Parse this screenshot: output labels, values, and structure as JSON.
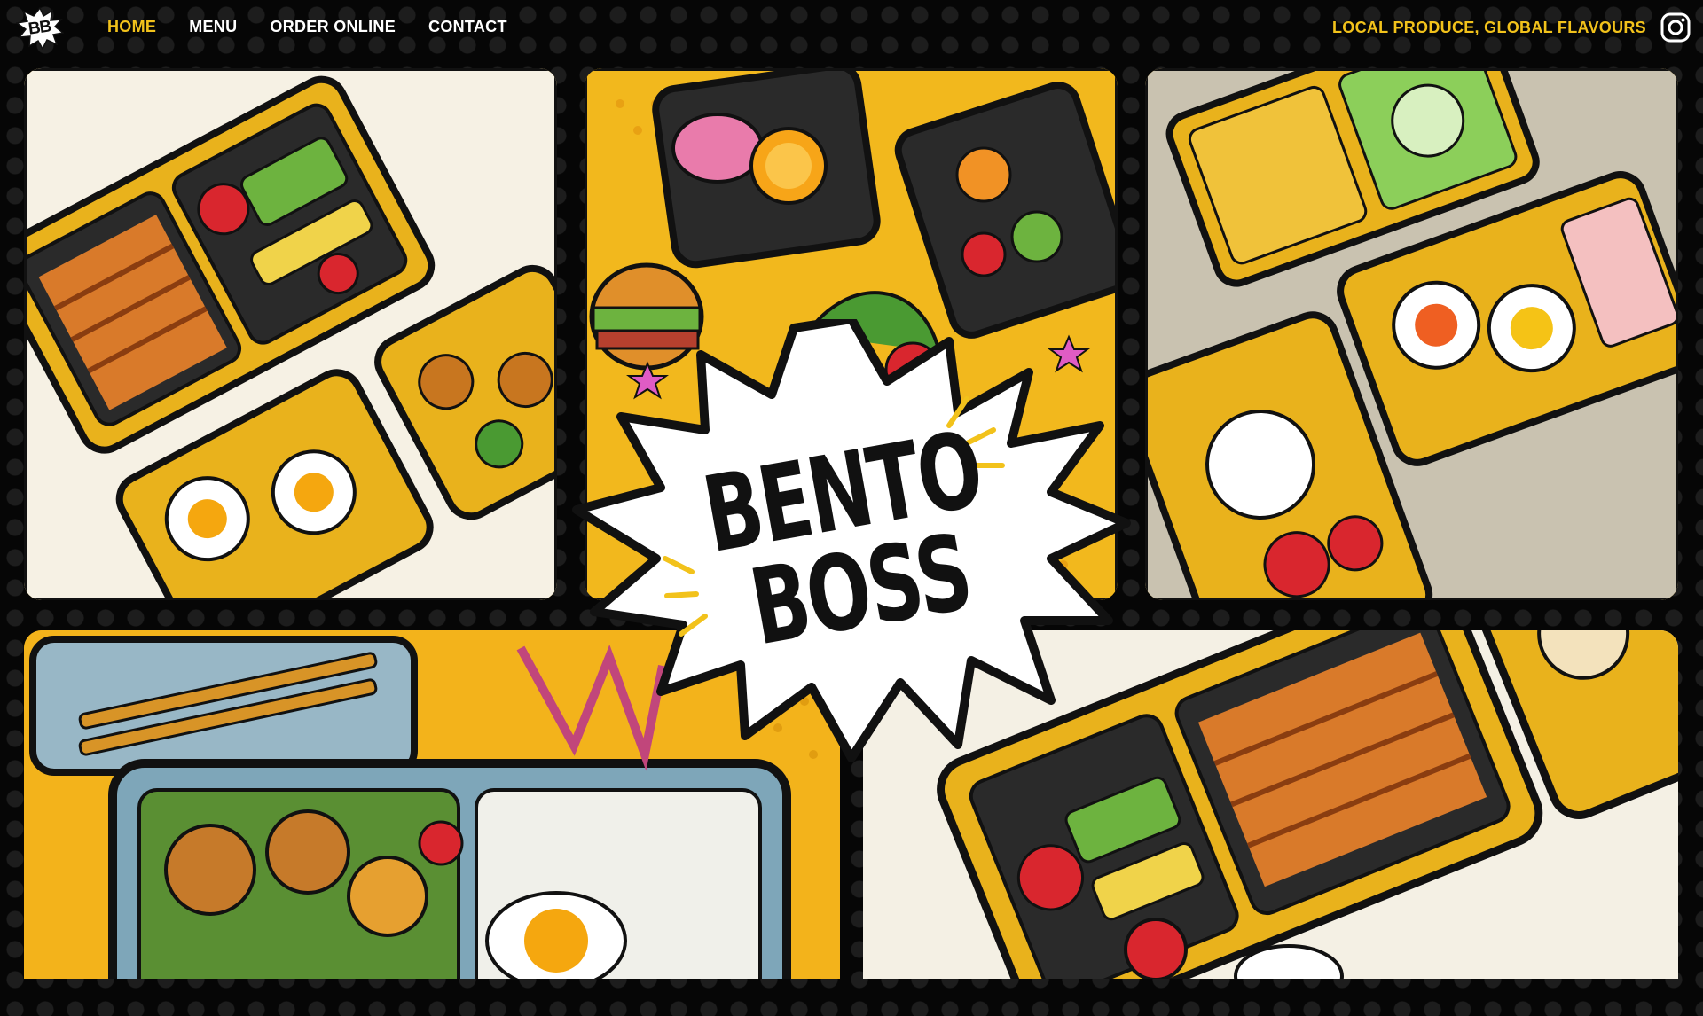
{
  "brand": {
    "logo_text": "BB",
    "title_line1": "BENTO",
    "title_line2": "BOSS"
  },
  "nav": {
    "items": [
      {
        "label": "HOME",
        "active": true
      },
      {
        "label": "MENU",
        "active": false
      },
      {
        "label": "ORDER ONLINE",
        "active": false
      },
      {
        "label": "CONTACT",
        "active": false
      }
    ]
  },
  "header": {
    "tagline": "LOCAL PRODUCE, GLOBAL FLAVOURS",
    "social_icon": "instagram-icon"
  },
  "colors": {
    "accent_yellow": "#f2c21b",
    "background": "#060606",
    "text_light": "#ffffff"
  },
  "gallery": {
    "panels": [
      {
        "icon": "bento-box-illustration"
      },
      {
        "icon": "bento-box-illustration"
      },
      {
        "icon": "bento-box-illustration"
      },
      {
        "icon": "bento-box-illustration"
      },
      {
        "icon": "bento-box-illustration"
      }
    ]
  }
}
